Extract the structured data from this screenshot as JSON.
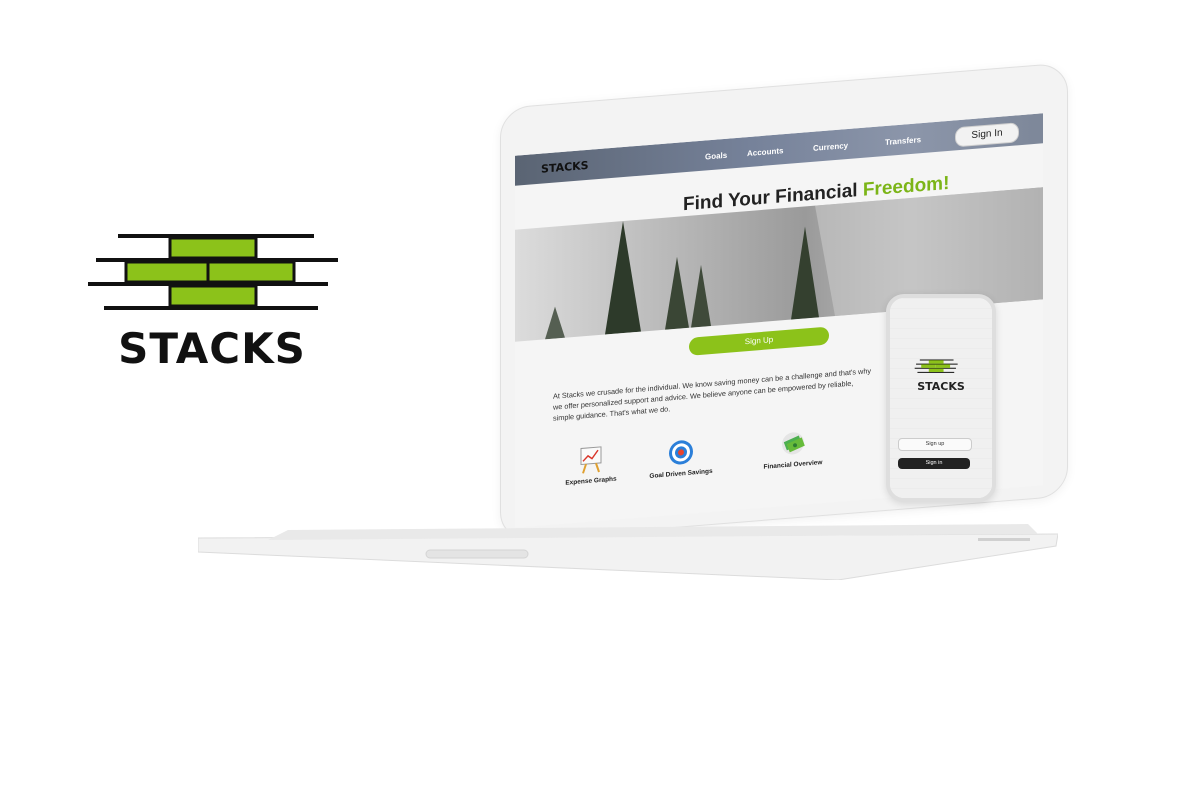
{
  "brand": {
    "name": "STACKS",
    "accent_color": "#8cc21a"
  },
  "site": {
    "nav": {
      "logo": "STACKS",
      "items": [
        "Goals",
        "Accounts",
        "Currency",
        "Transfers"
      ],
      "signin_label": "Sign In"
    },
    "hero": {
      "title_main": "Find Your Financial ",
      "title_accent": "Freedom!",
      "signup_label": "Sign Up"
    },
    "about": "At Stacks we crusade for the individual. We know saving money can be a challenge and that's why we offer personalized support and advice. We believe anyone can be empowered by reliable, simple guidance. That's what we do.",
    "features": [
      {
        "label": "Expense Graphs",
        "icon": "chart-easel-icon"
      },
      {
        "label": "Goal Driven Savings",
        "icon": "target-icon"
      },
      {
        "label": "Financial Overview",
        "icon": "money-stack-icon"
      }
    ]
  },
  "phone": {
    "logo": "STACKS",
    "signup_label": "Sign up",
    "signin_label": "Sign in"
  }
}
